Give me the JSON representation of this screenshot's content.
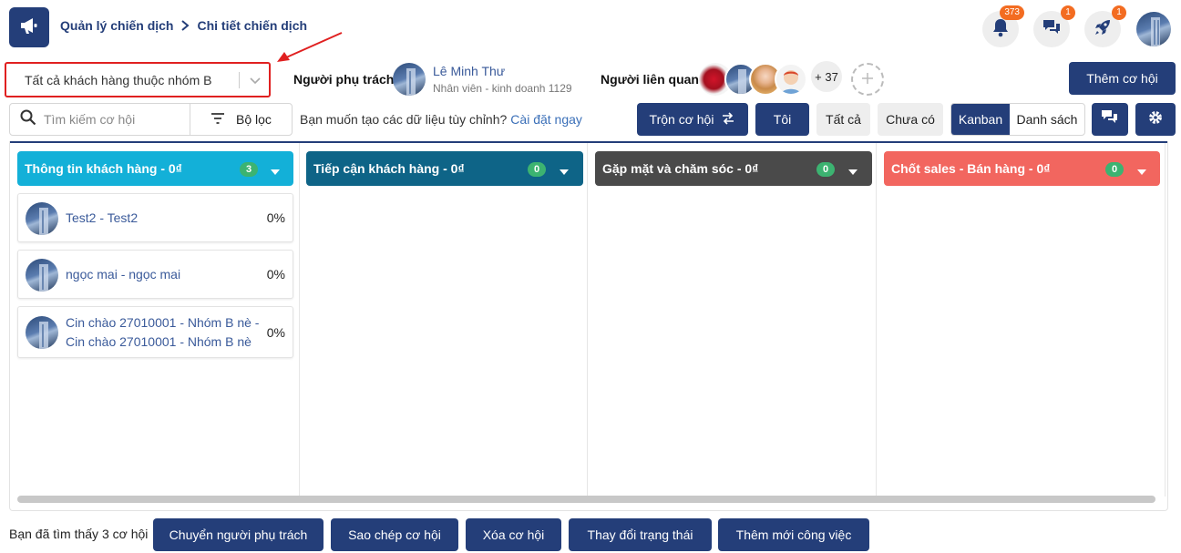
{
  "header": {
    "breadcrumb": [
      "Quản lý chiến dịch",
      "Chi tiết chiến dịch"
    ],
    "notifications_badge": "373",
    "messages_badge": "1",
    "launch_badge": "1"
  },
  "filter_bar": {
    "group_select_value": "Tất cả khách hàng thuộc nhóm B",
    "owner_label": "Người phụ trách",
    "owner_name": "Lê Minh Thư",
    "owner_title": "Nhân viên - kinh doanh 1129",
    "related_label": "Người liên quan",
    "related_more": "+ 37",
    "add_opportunity": "Thêm cơ hội"
  },
  "toolbar": {
    "search_placeholder": "Tìm kiếm cơ hội",
    "filter_label": "Bộ lọc",
    "custom_question": "Bạn muốn tạo các dữ liệu tùy chỉnh?",
    "custom_link": "Cài đặt ngay",
    "shuffle_label": "Trộn cơ hội",
    "me_label": "Tôi",
    "all_label": "Tất cả",
    "none_label": "Chưa có",
    "view_kanban": "Kanban",
    "view_list": "Danh sách"
  },
  "columns": [
    {
      "title": "Thông tin khách hàng - 0₫",
      "count": "3",
      "color": "#13b0d8"
    },
    {
      "title": "Tiếp cận khách hàng - 0₫",
      "count": "0",
      "color": "#0e6487"
    },
    {
      "title": "Gặp mặt và chăm sóc - 0₫",
      "count": "0",
      "color": "#4a4a4a"
    },
    {
      "title": "Chốt sales - Bán hàng - 0₫",
      "count": "0",
      "color": "#f2665f"
    }
  ],
  "cards": [
    {
      "title": "Test2 - Test2",
      "percent": "0%"
    },
    {
      "title": "ngọc mai - ngọc mai",
      "percent": "0%"
    },
    {
      "title_line1": "Cin chào 27010001 - Nhóm B nè -",
      "title_line2": "Cin chào 27010001 - Nhóm B nè",
      "percent": "0%"
    }
  ],
  "footer": {
    "found_text": "Bạn đã tìm thấy 3 cơ hội",
    "transfer_owner": "Chuyển người phụ trách",
    "copy_opportunity": "Sao chép cơ hội",
    "delete_opportunity": "Xóa cơ hội",
    "change_status": "Thay đổi trạng thái",
    "add_task": "Thêm mới công việc"
  },
  "icons": [
    "megaphone-icon",
    "chevron-right-icon",
    "bell-icon",
    "chat-icon",
    "rocket-icon",
    "chevron-down-icon",
    "search-icon",
    "filter-icon",
    "shuffle-icon",
    "gear-icon",
    "plus-icon"
  ],
  "colors": {
    "primary": "#243e79",
    "badge": "#f36c21",
    "count_green": "#3cb371",
    "highlight_red": "#e02020"
  }
}
